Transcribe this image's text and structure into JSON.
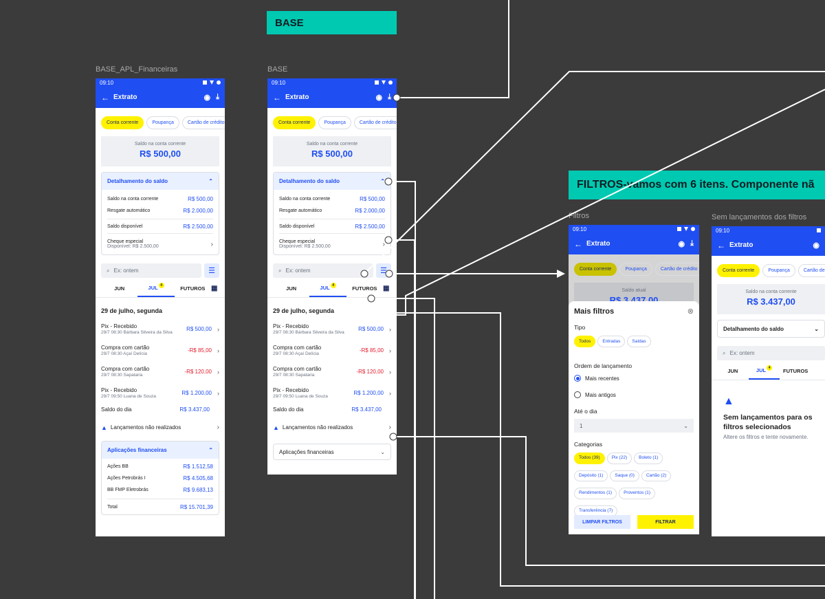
{
  "headers": {
    "base": "BASE",
    "filtros": "FILTROS-vamos com 6 itens. Componente nã"
  },
  "labels": {
    "frame1": "BASE_APL_Financeiras",
    "frame2": "BASE",
    "frame3": "Filtros",
    "frame4": "Sem lançamentos dos filtros"
  },
  "app": {
    "time": "09:10",
    "title": "Extrato",
    "chips": [
      "Conta corrente",
      "Poupança",
      "Cartão de crédito"
    ],
    "saldo_label": "Saldo na conta corrente",
    "saldo_value": "R$ 500,00",
    "detalhamento_title": "Detalhamento do saldo",
    "detalhamento_rows": [
      {
        "label": "Saldo na conta corrente",
        "value": "R$ 500,00"
      },
      {
        "label": "Resgate automático",
        "value": "R$ 2.000,00"
      },
      {
        "label": "Saldo disponível",
        "value": "R$ 2.500,00"
      }
    ],
    "cheque_label": "Cheque especial",
    "cheque_sub": "Disponível: R$ 2.500,00",
    "search_placeholder": "Ex: ontem",
    "tabs": [
      "JUN",
      "JUL",
      "FUTUROS"
    ],
    "tab_badge": "4",
    "date_header": "29 de julho, segunda",
    "transactions": [
      {
        "name": "Pix - Recebido",
        "sub": "29/7 08:30 Bárbara Silveira da Silva",
        "amount": "R$ 500,00",
        "type": "pos"
      },
      {
        "name": "Compra com cartão",
        "sub": "29/7 08:30 Açaí Delícia",
        "amount": "-R$ 85,00",
        "type": "neg"
      },
      {
        "name": "Compra com cartão",
        "sub": "29/7 08:30 Sapataria",
        "amount": "-R$ 120,00",
        "type": "neg"
      },
      {
        "name": "Pix - Recebido",
        "sub": "29/7 09:50 Luana de Souza",
        "amount": "R$ 1.200,00",
        "type": "pos"
      }
    ],
    "saldo_dia_label": "Saldo do dia",
    "saldo_dia_value": "R$ 3.437,00",
    "lancamentos_nr": "Lançamentos não realizados",
    "aplicacoes_title": "Aplicações financeiras",
    "aplicacoes_rows": [
      {
        "label": "Ações BB",
        "value": "R$ 1.512,58"
      },
      {
        "label": "Ações Petrobrás I",
        "value": "R$ 4.505,68"
      },
      {
        "label": "BB FMP Eletrobrás",
        "value": "R$ 9.683,13"
      }
    ],
    "total_label": "Total",
    "total_value": "R$ 15.701,39"
  },
  "filtros": {
    "saldo_label": "Saldo atual",
    "saldo_value": "R$ 3.437,00",
    "sheet_title": "Mais filtros",
    "tipo_label": "Tipo",
    "tipo_chips": [
      "Todos",
      "Entradas",
      "Saídas"
    ],
    "ordem_label": "Ordem de lançamento",
    "ordem_options": [
      "Mais recentes",
      "Mais antigos"
    ],
    "ate_label": "Até o dia",
    "ate_value": "1",
    "categorias_label": "Categorias",
    "categorias": [
      "Todos (39)",
      "Pix (22)",
      "Boleto (1)",
      "Depósito (1)",
      "Saque (0)",
      "Cartão (2)",
      "Rendimentos (1)",
      "Proventos (1)",
      "Transferência (7)"
    ],
    "limpar": "LIMPAR FILTROS",
    "filtrar": "FILTRAR"
  },
  "sem": {
    "saldo_value": "R$ 3.437,00",
    "title": "Sem lançamentos para os filtros selecionados",
    "sub": "Altere os filtros e tente novamente."
  },
  "colors": {
    "primary": "#1f4ef2",
    "accent": "#fff200",
    "teal": "#00c9b1",
    "canvas": "#3b3b3b",
    "negative": "#e11d2e"
  }
}
